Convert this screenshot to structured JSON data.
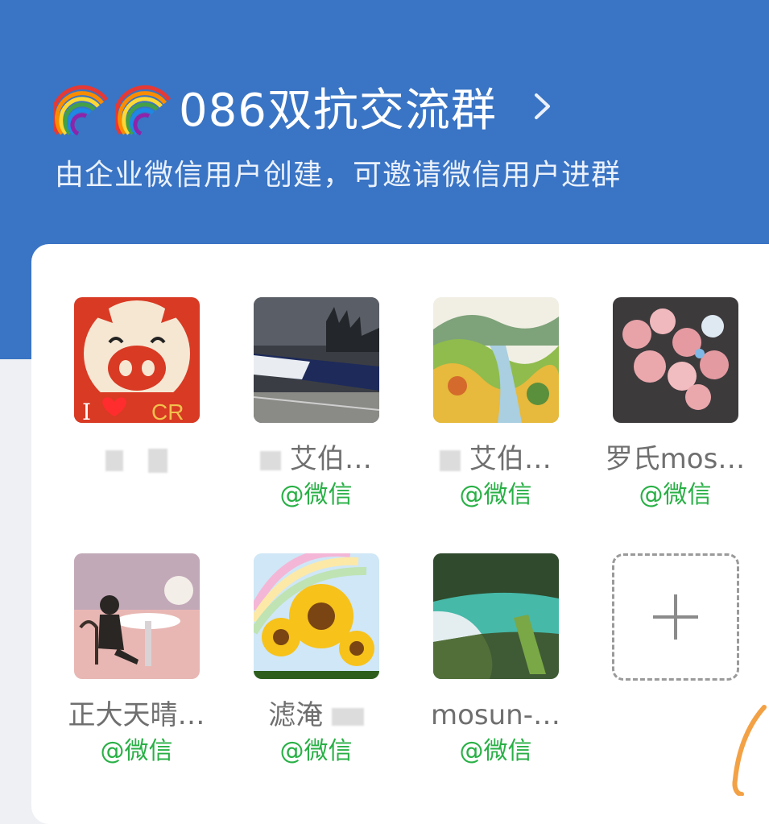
{
  "header": {
    "title": "086双抗交流群",
    "title_prefix_icons": [
      "rainbow-icon",
      "rainbow-icon"
    ],
    "subtitle": "由企业微信用户创建，可邀请微信用户进群"
  },
  "members": [
    {
      "name": "",
      "tag": "",
      "avatar": "pig-icon"
    },
    {
      "name": "艾伯…",
      "tag": "@微信",
      "avatar": "train-photo"
    },
    {
      "name": "艾伯…",
      "tag": "@微信",
      "avatar": "landscape-painting"
    },
    {
      "name": "罗氏mos…",
      "tag": "@微信",
      "avatar": "roses-photo"
    },
    {
      "name": "正大天晴…",
      "tag": "@微信",
      "avatar": "cafe-illustration"
    },
    {
      "name": "滤淹",
      "tag": "@微信",
      "avatar": "sunflower-photo"
    },
    {
      "name": "mosun-…",
      "tag": "@微信",
      "avatar": "waterfall-photo"
    }
  ],
  "add_member": {
    "icon": "plus-icon"
  },
  "pig_avatar_text": {
    "left": "I",
    "right": "CR"
  },
  "colors": {
    "header_bg": "#3a74c4",
    "tag_green": "#28b045"
  }
}
